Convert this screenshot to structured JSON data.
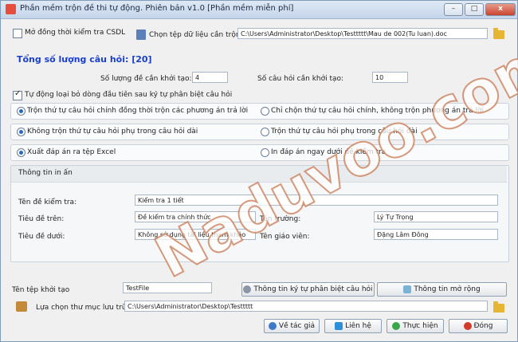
{
  "window": {
    "title": "Phần mềm trộn đề thi tự động. Phiên bản v1.0  [Phần mềm miễn phí]",
    "min_label": "–",
    "max_label": "□",
    "close_label": "x"
  },
  "top": {
    "db_check_label": "Mở đồng thời kiểm tra CSDL",
    "db_check_checked": false,
    "choose_file_label": "Chọn tệp dữ liệu cần trộn:",
    "file_path": "C:\\Users\\Administrator\\Desktop\\Testtttt\\Mau de 002(Tu luan).doc"
  },
  "summary": {
    "total_label": "Tổng số lượng câu hỏi: [20]",
    "num_tests_label": "Số lượng đề cần khởi tạo:",
    "num_tests_value": "4",
    "num_questions_label": "Số câu hỏi cần khởi tạo:",
    "num_questions_value": "10",
    "auto_remove_label": "Tự động loại bỏ dòng đầu tiên sau ký tự phân biệt câu hỏi",
    "auto_remove_checked": true
  },
  "options": [
    {
      "left": {
        "label": "Trộn thứ tự câu hỏi chính đồng thời trộn các phương án trả lời",
        "selected": true
      },
      "right": {
        "label": "Chỉ chộn thứ tự câu hỏi chính, không trộn phương án trả lời",
        "selected": false
      }
    },
    {
      "left": {
        "label": "Không trộn thứ tự câu hỏi phụ trong câu hỏi dài",
        "selected": true
      },
      "right": {
        "label": "Trộn thứ tự câu hỏi phụ trong câu hỏi dài",
        "selected": false
      }
    },
    {
      "left": {
        "label": "Xuất đáp án ra tệp Excel",
        "selected": true
      },
      "right": {
        "label": "In đáp án ngay dưới đề kiểm tra",
        "selected": false
      }
    }
  ],
  "print_info": {
    "group_title": "Thông tin in ấn",
    "test_name_label": "Tên đề kiểm tra:",
    "test_name_value": "Kiểm tra 1 tiết",
    "header_label": "Tiêu đề trên:",
    "header_value": "Đề kiểm tra chính thức",
    "school_label": "Tên trường:",
    "school_value": "Lý Tự Trọng",
    "footer_label": "Tiêu đề dưới:",
    "footer_value": "Không sử dụng tài liệu tham khảo",
    "teacher_label": "Tên giáo viên:",
    "teacher_value": "Đặng Lâm Đông"
  },
  "bottom": {
    "output_name_label": "Tên tệp khởi tạo",
    "output_name_value": "TestFile",
    "separator_info_button": "Thông tin ký tự phân biệt câu hỏi",
    "more_info_button": "Thông tin mở rộng",
    "folder_label": "Lựa chọn thư mục lưu trữ",
    "folder_path": "C:\\Users\\Administrator\\Desktop\\Testtttt",
    "about_button": "Về tác giả",
    "contact_button": "Liên hệ",
    "run_button": "Thực hiện",
    "close_button": "Đóng"
  },
  "watermark": "Naduvoo.com",
  "colors": {
    "heading": "#1a3fd0",
    "titlebar": "#c4d5ea",
    "folder": "#e6b534"
  }
}
